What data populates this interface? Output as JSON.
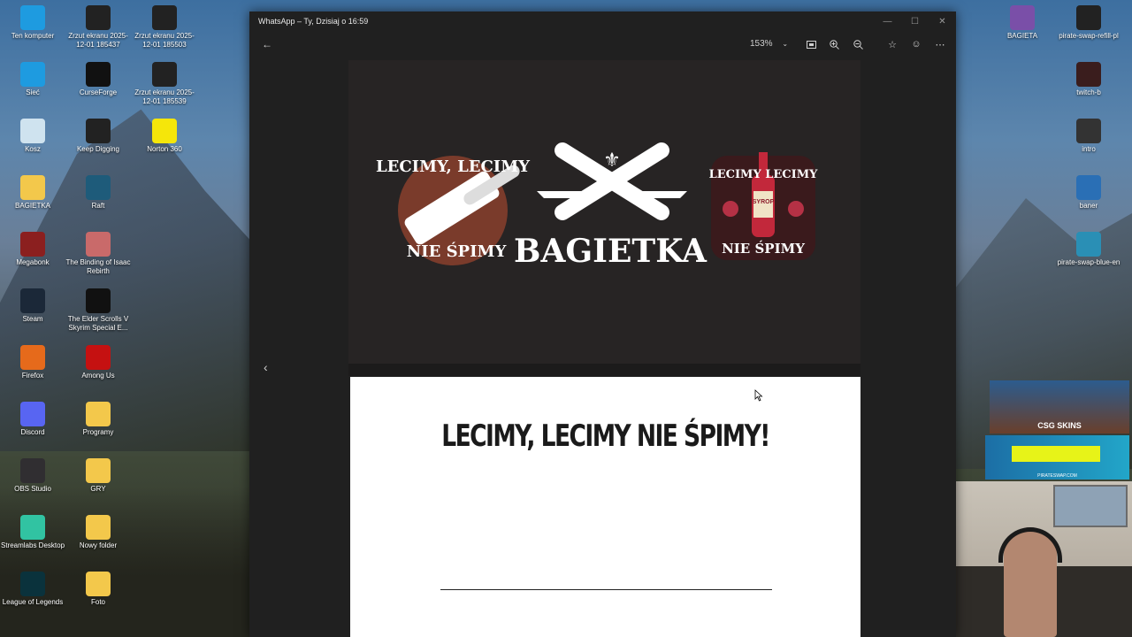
{
  "desktop": {
    "left_icons": [
      {
        "label": "Ten komputer",
        "icon": "monitor-icon",
        "color": "#1e9be0"
      },
      {
        "label": "Sieć",
        "icon": "network-icon",
        "color": "#1e9be0"
      },
      {
        "label": "Kosz",
        "icon": "recycle-bin-icon",
        "color": "#cfe3ef"
      },
      {
        "label": "BAGIETKA",
        "icon": "folder-icon",
        "color": "#f3c84b"
      },
      {
        "label": "Megabonk",
        "icon": "game-icon",
        "color": "#8b1f1f"
      },
      {
        "label": "Steam",
        "icon": "steam-icon",
        "color": "#1b2838"
      },
      {
        "label": "Firefox",
        "icon": "firefox-icon",
        "color": "#e66a1b"
      },
      {
        "label": "Discord",
        "icon": "discord-icon",
        "color": "#5865f2"
      },
      {
        "label": "OBS Studio",
        "icon": "obs-icon",
        "color": "#302e31"
      },
      {
        "label": "Streamlabs Desktop",
        "icon": "streamlabs-icon",
        "color": "#31c3a2"
      },
      {
        "label": "League of Legends",
        "icon": "lol-icon",
        "color": "#0a323c"
      }
    ],
    "col2_icons": [
      {
        "label": "Zrzut ekranu 2025-12-01 185437",
        "icon": "screenshot-icon",
        "color": "#222"
      },
      {
        "label": "CurseForge",
        "icon": "curseforge-icon",
        "color": "#111"
      },
      {
        "label": "Keep Digging",
        "icon": "pickaxe-icon",
        "color": "#222"
      },
      {
        "label": "Raft",
        "icon": "raft-icon",
        "color": "#1e5b7a"
      },
      {
        "label": "The Binding of Isaac Rebirth",
        "icon": "isaac-icon",
        "color": "#c96a6a"
      },
      {
        "label": "The Elder Scrolls V Skyrim Special E...",
        "icon": "skyrim-icon",
        "color": "#111"
      },
      {
        "label": "Among Us",
        "icon": "among-us-icon",
        "color": "#c51111"
      },
      {
        "label": "Programy",
        "icon": "folder-icon",
        "color": "#f3c84b"
      },
      {
        "label": "GRY",
        "icon": "folder-icon",
        "color": "#f3c84b"
      },
      {
        "label": "Nowy folder",
        "icon": "folder-icon",
        "color": "#f3c84b"
      },
      {
        "label": "Foto",
        "icon": "folder-icon",
        "color": "#f3c84b"
      }
    ],
    "col3_icons": [
      {
        "label": "Zrzut ekranu 2025-12-01 185503",
        "icon": "screenshot-icon",
        "color": "#222"
      },
      {
        "label": "Zrzut ekranu 2025-12-01 185539",
        "icon": "screenshot-icon",
        "color": "#222"
      },
      {
        "label": "Norton 360",
        "icon": "norton-icon",
        "color": "#f5e60a"
      }
    ],
    "right_icons": [
      {
        "label": "BAGIETA",
        "icon": "image-icon",
        "color": "#7a4fa8"
      },
      {
        "label": "pirate-swap-refill-pl",
        "icon": "video-icon",
        "color": "#222"
      },
      {
        "label": "twitch-b",
        "icon": "video-icon",
        "color": "#3a1d1d"
      },
      {
        "label": "intro",
        "icon": "video-icon",
        "color": "#333"
      },
      {
        "label": "baner",
        "icon": "image-icon",
        "color": "#2a6fb5"
      },
      {
        "label": "pirate-swap-blue-en",
        "icon": "image-icon",
        "color": "#2a8fb5"
      }
    ]
  },
  "viewer": {
    "title": "WhatsApp – Ty, Dzisiaj o 16:59",
    "zoom": "153%",
    "controls": {
      "minimize": "—",
      "maximize": "☐",
      "close": "✕"
    },
    "toolbar_icons": [
      "fit-icon",
      "zoom-in-icon",
      "zoom-out-icon",
      "favorite-icon",
      "emoji-icon",
      "more-icon"
    ],
    "logos": {
      "left_arc": "LECIMY, LECIMY",
      "left_bottom": "NIE ŚPIMY",
      "center": "BAGIETKA",
      "right_top": "LECIMY LECIMY",
      "right_label": "SYROP",
      "right_bottom": "NIE ŚPIMY"
    },
    "headline": "LECIMY, LECIMY NIE ŚPIMY!"
  },
  "overlays": {
    "csgo": "CSG SKINS",
    "pirateswap": "PIRATESWAP.COM"
  }
}
